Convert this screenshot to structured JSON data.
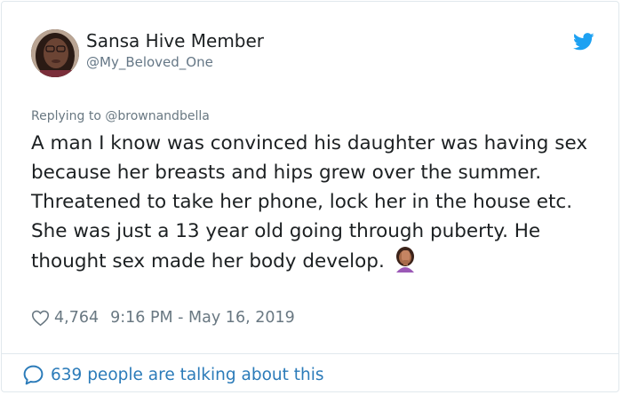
{
  "author": {
    "name": "Sansa Hive Member",
    "handle": "@My_Beloved_One"
  },
  "reply": {
    "text": "Replying to @brownandbella"
  },
  "tweet": {
    "text": "A man I know was convinced his daughter was having sex because her breasts and hips grew over the summer. Threatened to take her phone, lock her in the house etc. She was just a 13 year old going through puberty. He thought sex made her body develop.",
    "emoji": "face-palm-emoji"
  },
  "meta": {
    "likes": "4,764",
    "timestamp": "9:16 PM - May 16, 2019"
  },
  "footer": {
    "talking": "639 people are talking about this"
  },
  "colors": {
    "twitter_blue": "#1da1f2",
    "link_blue": "#2b7bb9",
    "muted": "#697882",
    "border": "#e1e8ed"
  },
  "icons": [
    "twitter-bird-icon",
    "heart-icon",
    "speech-bubble-icon"
  ]
}
